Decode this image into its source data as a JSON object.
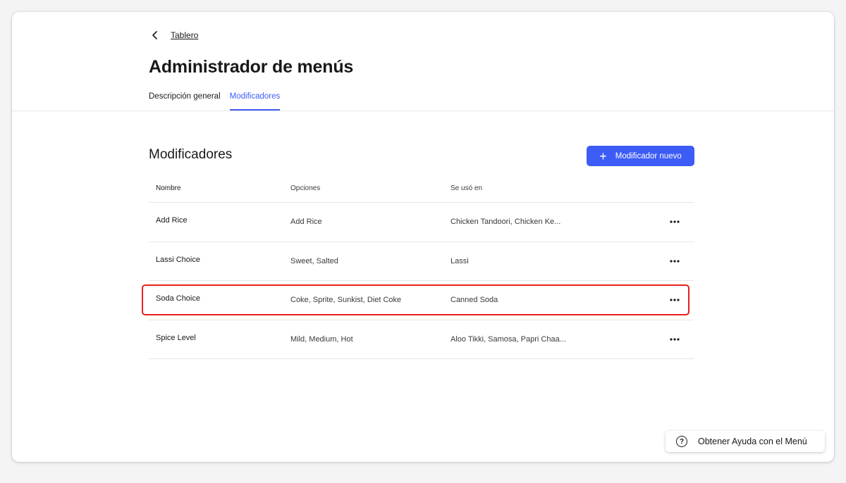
{
  "breadcrumb": {
    "back_label": "Tablero"
  },
  "page": {
    "title": "Administrador de menús"
  },
  "tabs": [
    {
      "label": "Descripción general",
      "active": false
    },
    {
      "label": "Modificadores",
      "active": true
    }
  ],
  "section": {
    "title": "Modificadores",
    "new_button_label": "Modificador nuevo"
  },
  "table": {
    "headers": {
      "name": "Nombre",
      "options": "Opciones",
      "used_in": "Se usó en"
    },
    "rows": [
      {
        "name": "Add Rice",
        "options": "Add Rice",
        "used_in": "Chicken Tandoori, Chicken Ke..."
      },
      {
        "name": "Lassi Choice",
        "options": "Sweet, Salted",
        "used_in": "Lassi"
      },
      {
        "name": "Soda Choice",
        "options": "Coke, Sprite, Sunkist, Diet Coke",
        "used_in": "Canned Soda"
      },
      {
        "name": "Spice Level",
        "options": "Mild, Medium, Hot",
        "used_in": "Aloo Tikki, Samosa, Papri Chaa..."
      }
    ]
  },
  "help": {
    "label": "Obtener Ayuda con el Menú"
  },
  "colors": {
    "accent": "#3d5cf5",
    "highlight": "#e8201a"
  }
}
